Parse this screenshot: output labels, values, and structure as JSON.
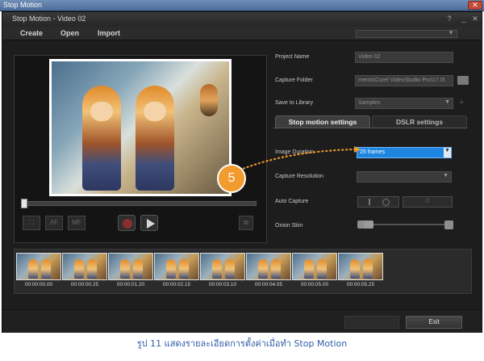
{
  "os_window": {
    "title": "Stop Motion",
    "close_icon": "close-icon"
  },
  "app_window": {
    "title": "Stop Motion - Video 02"
  },
  "menu": [
    "Create",
    "Open",
    "Import"
  ],
  "settings": {
    "project_name": {
      "label": "Project Name",
      "value": "Video 02"
    },
    "capture_folder": {
      "label": "Capture Folder",
      "value": "ments\\Corel VideoStudio Pro\\17.0\\"
    },
    "save_to_library": {
      "label": "Save to Library",
      "value": "Samples"
    },
    "tabs": [
      "Stop motion settings",
      "DSLR settings"
    ],
    "active_tab": "Stop motion settings",
    "image_duration": {
      "label": "Image Duration",
      "value": "25 frames"
    },
    "capture_resolution": {
      "label": "Capture Resolution",
      "value": ""
    },
    "auto_capture": {
      "label": "Auto Capture"
    },
    "onion_skin": {
      "label": "Onion Skin",
      "level": 0.0
    }
  },
  "annotation": {
    "number": "5",
    "color": "#f29b2e"
  },
  "timeline": {
    "timecodes": [
      "00:00:00.00",
      "00:00:00.25",
      "00:00:01.20",
      "00:00:02.15",
      "00:00:03.10",
      "00:00:04.05",
      "00:00:05.00",
      "00:00:05.25"
    ]
  },
  "buttons": {
    "exit": "Exit"
  },
  "caption": "รูป 11 แสดงรายละเอียดการตั้งค่าเมื่อทำ Stop Motion",
  "colors": {
    "selection_blue": "#1e86e0",
    "app_background": "#1d1d1d",
    "caption_text": "#2d5ca8"
  }
}
